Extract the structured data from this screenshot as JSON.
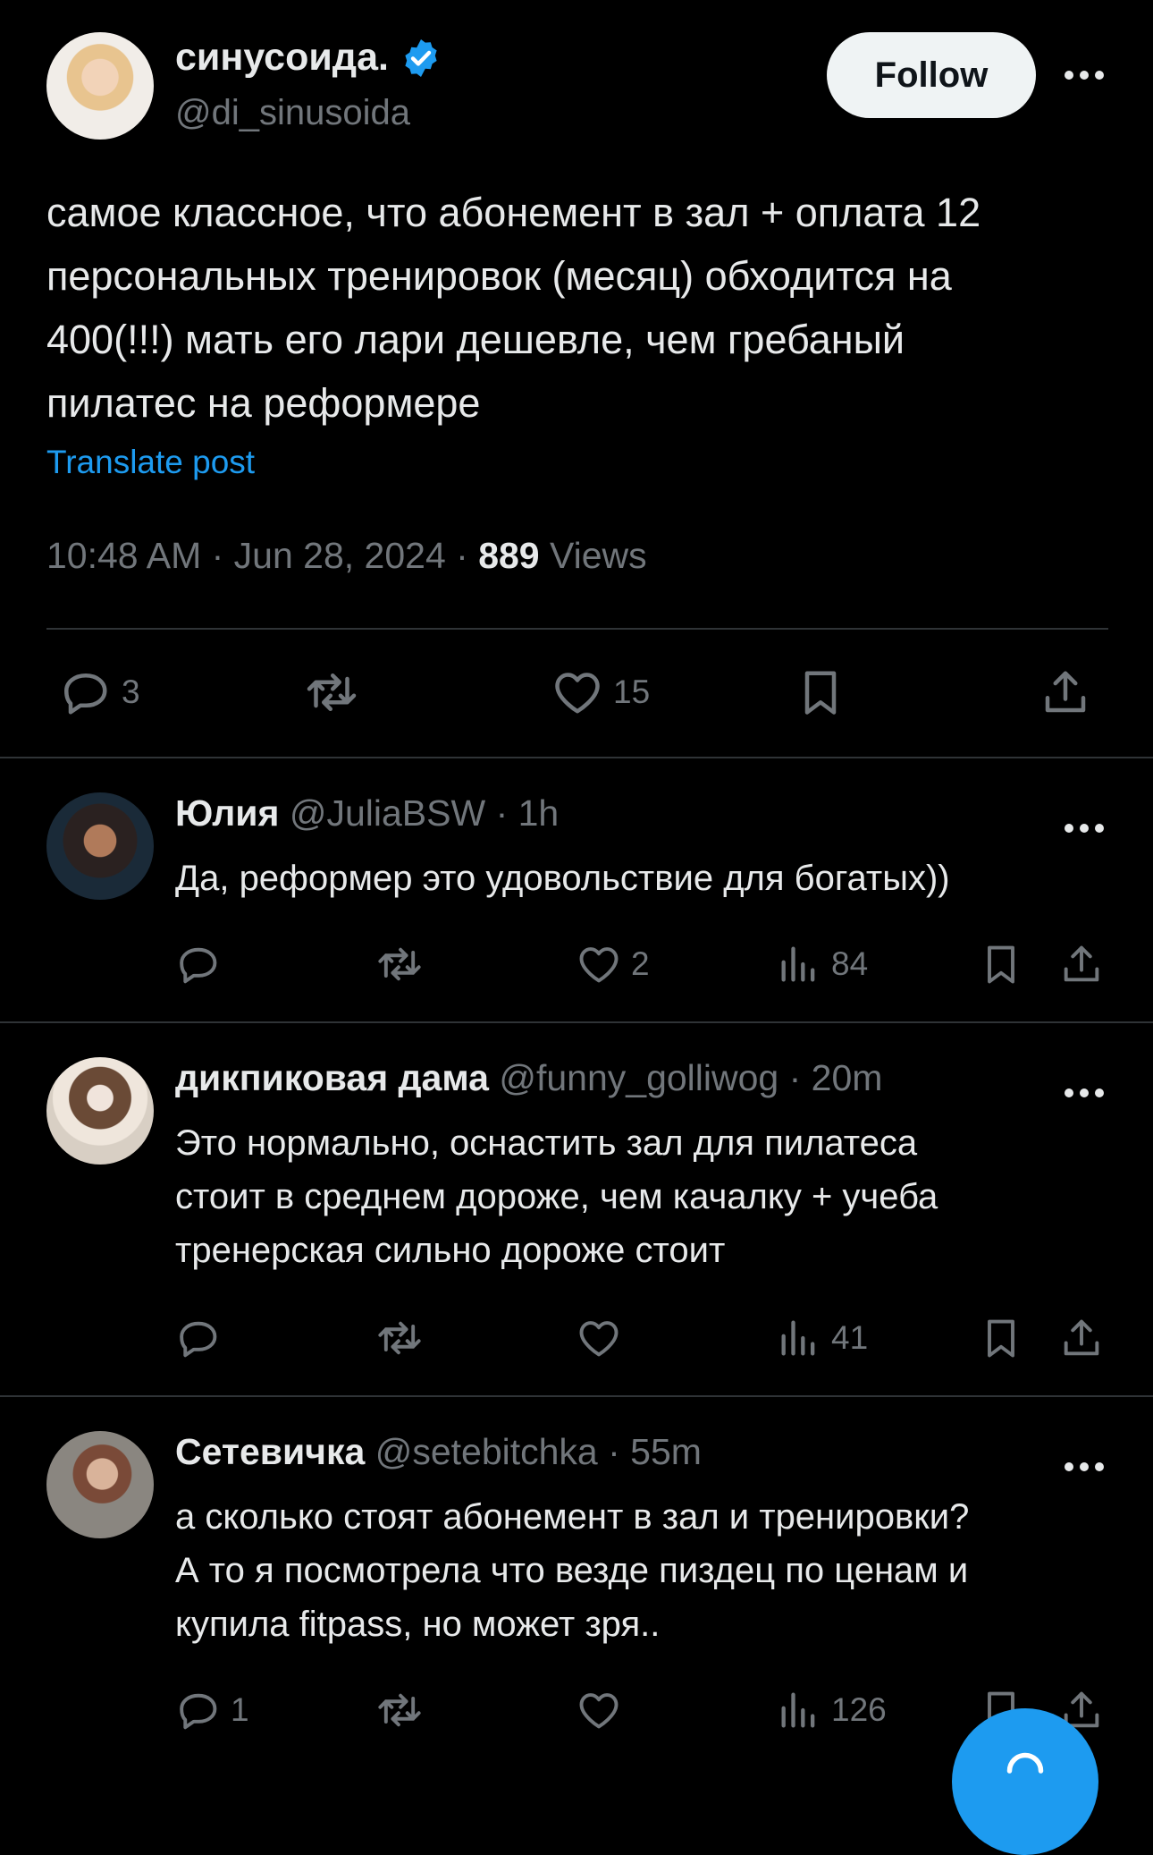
{
  "main_tweet": {
    "display_name": "синусоида.",
    "handle": "@di_sinusoida",
    "follow_label": "Follow",
    "text": "самое классное, что абонемент в зал + оплата 12\nперсональных тренировок (месяц) обходится на\n400(!!!) мать его лари дешевле, чем гребаный\nпилатес на реформере",
    "translate_label": "Translate post",
    "time": "10:48 AM · Jun 28, 2024 · ",
    "views_count": "889",
    "views_label": " Views",
    "replies": "3",
    "likes": "15"
  },
  "replies": [
    {
      "name": "Юлия",
      "handle": "@JuliaBSW",
      "time": " · 1h",
      "text": "Да, реформер это удовольствие для богатых))",
      "replies": "",
      "likes": "2",
      "views": "84"
    },
    {
      "name": "дикпиковая дама",
      "handle": "@funny_golliwog",
      "time": " · 20m",
      "text": "Это нормально, оснастить зал для пилатеса\nстоит в среднем дороже, чем качалку + учеба\nтренерская сильно дороже стоит",
      "replies": "",
      "likes": "",
      "views": "41"
    },
    {
      "name": "Сетевичка",
      "handle": "@setebitchka",
      "time": " · 55m",
      "text": "а сколько стоят абонемент в зал и тренировки?\nА то я посмотрела что везде пиздец по ценам и\nкупила fitpass, но может зря..",
      "replies": "1",
      "likes": "",
      "views": "126"
    }
  ],
  "colors": {
    "accent": "#1d9bf0",
    "verified": "#1d9bf0",
    "muted": "#71767b",
    "text": "#e7e9ea",
    "background": "#000000"
  }
}
